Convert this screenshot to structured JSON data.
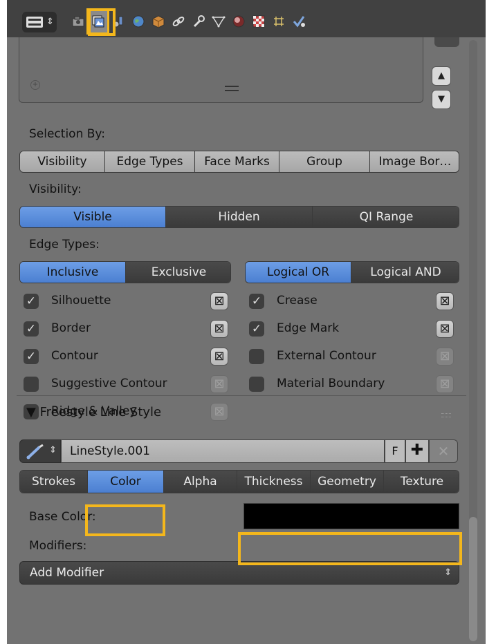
{
  "header": {
    "context_icon": "screen-layout-icon",
    "property_tabs": [
      {
        "icon": "render-icon"
      },
      {
        "icon": "render-layers-icon",
        "active": true
      },
      {
        "icon": "scene-icon"
      },
      {
        "icon": "world-icon"
      },
      {
        "icon": "object-icon"
      },
      {
        "icon": "constraints-icon"
      },
      {
        "icon": "modifiers-icon"
      },
      {
        "icon": "data-icon"
      },
      {
        "icon": "material-icon"
      },
      {
        "icon": "texture-icon"
      },
      {
        "icon": "particles-icon"
      },
      {
        "icon": "physics-icon"
      }
    ]
  },
  "selection_by": {
    "label": "Selection By:",
    "options": [
      "Visibility",
      "Edge Types",
      "Face Marks",
      "Group",
      "Image Bor…"
    ]
  },
  "visibility": {
    "label": "Visibility:",
    "options": [
      "Visible",
      "Hidden",
      "QI Range"
    ],
    "selected": "Visible"
  },
  "edge_types": {
    "label": "Edge Types:",
    "mode_options": [
      "Inclusive",
      "Exclusive"
    ],
    "mode_selected": "Inclusive",
    "logic_options": [
      "Logical OR",
      "Logical AND"
    ],
    "logic_selected": "Logical OR",
    "left": [
      {
        "label": "Silhouette",
        "checked": true
      },
      {
        "label": "Border",
        "checked": true
      },
      {
        "label": "Contour",
        "checked": true
      },
      {
        "label": "Suggestive Contour",
        "checked": false
      },
      {
        "label": "Ridge & Valley",
        "checked": false
      }
    ],
    "right": [
      {
        "label": "Crease",
        "checked": true
      },
      {
        "label": "Edge Mark",
        "checked": true
      },
      {
        "label": "External Contour",
        "checked": false
      },
      {
        "label": "Material Boundary",
        "checked": false
      }
    ]
  },
  "line_style_panel": {
    "title": "Freestyle Line Style",
    "datablock_name": "LineStyle.001",
    "fake_user": "F",
    "tabs": [
      "Strokes",
      "Color",
      "Alpha",
      "Thickness",
      "Geometry",
      "Texture"
    ],
    "active_tab": "Color",
    "base_color_label": "Base Color:",
    "base_color_value": "#000000",
    "modifiers_label": "Modifiers:",
    "add_modifier": "Add Modifier"
  },
  "colors": {
    "highlight": "#f4b71c",
    "selected": "#5680c2",
    "panel": "#727272"
  }
}
